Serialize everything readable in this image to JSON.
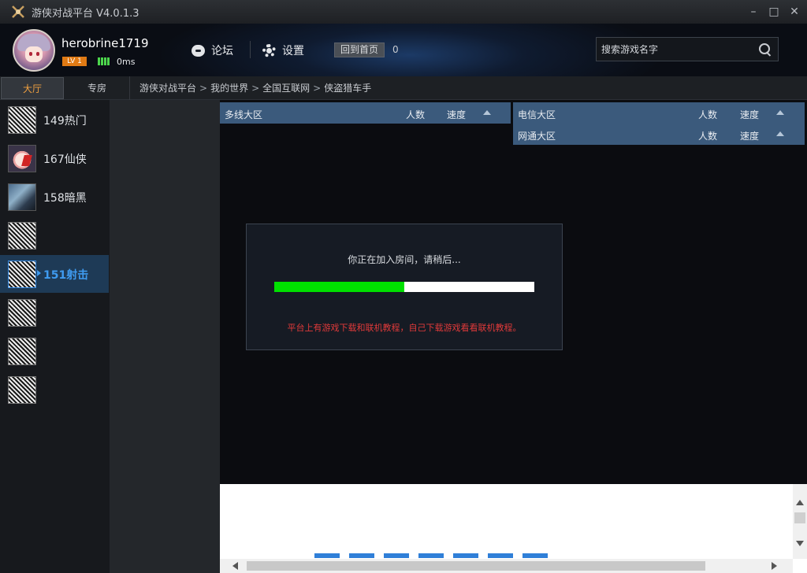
{
  "window": {
    "title": "游侠对战平台 V4.0.1.3",
    "minimize": "–",
    "maximize": "□",
    "close": "✕"
  },
  "user": {
    "name": "herobrine1719",
    "level": "LV 1",
    "ping": "0ms"
  },
  "header": {
    "forum_label": "论坛",
    "settings_label": "设置",
    "home_label": "回到首页",
    "home_count": "0",
    "search_placeholder": "搜索游戏名字"
  },
  "tabs": {
    "hall": "大厅",
    "zone": "专房"
  },
  "breadcrumb": {
    "items": [
      "游侠对战平台",
      "我的世界",
      "全国互联网",
      "侠盗猎车手"
    ],
    "separator": ">"
  },
  "sidebar": {
    "items": [
      {
        "label": "149热门",
        "thumb": "pattern-icon"
      },
      {
        "label": "167仙侠",
        "thumb": "girl-avatar-icon"
      },
      {
        "label": "158暗黑",
        "thumb": "warrior-avatar-icon"
      },
      {
        "label": "",
        "thumb": "pattern-icon"
      },
      {
        "label": "151射击",
        "thumb": "pattern-icon",
        "active": true
      },
      {
        "label": "",
        "thumb": "pattern-icon"
      },
      {
        "label": "",
        "thumb": "pattern-icon"
      },
      {
        "label": "",
        "thumb": "pattern-icon"
      }
    ]
  },
  "zones": {
    "multi": {
      "name": "多线大区",
      "count": "人数",
      "speed": "速度"
    },
    "telecom": {
      "name": "电信大区",
      "count": "人数",
      "speed": "速度"
    },
    "netcom": {
      "name": "网通大区",
      "count": "人数",
      "speed": "速度"
    }
  },
  "dialog": {
    "message": "你正在加入房间，请稍后...",
    "progress_fraction": 0.5,
    "tip": "平台上有游戏下载和联机教程，自己下载游戏看看联机教程。"
  },
  "colors": {
    "accent_orange": "#f0a040",
    "active_blue": "#3f9bf0",
    "zone_header": "#3b5a7c",
    "progress_green": "#00e000",
    "tip_red": "#e03a3a"
  }
}
